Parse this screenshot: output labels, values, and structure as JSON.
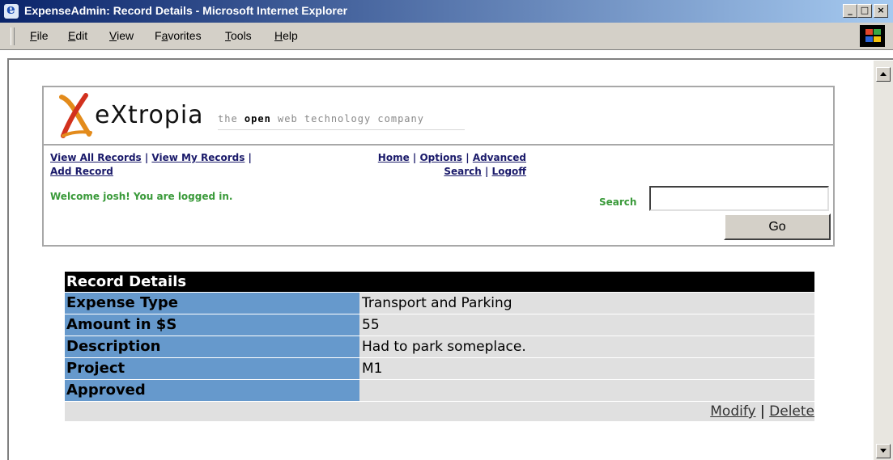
{
  "window": {
    "title": "ExpenseAdmin: Record Details - Microsoft Internet Explorer",
    "controls": {
      "minimize": "_",
      "maximize": "□",
      "close": "×"
    }
  },
  "menubar": {
    "items": [
      {
        "pre": "",
        "key": "F",
        "post": "ile"
      },
      {
        "pre": "",
        "key": "E",
        "post": "dit"
      },
      {
        "pre": "",
        "key": "V",
        "post": "iew"
      },
      {
        "pre": "F",
        "key": "a",
        "post": "vorites"
      },
      {
        "pre": "",
        "key": "T",
        "post": "ools"
      },
      {
        "pre": "",
        "key": "H",
        "post": "elp"
      }
    ]
  },
  "header": {
    "logo_text": "eXtropia",
    "tagline_pre": "the ",
    "tagline_open": "open",
    "tagline_post": " web technology company"
  },
  "nav": {
    "view_all": "View All Records",
    "view_my": "View My Records",
    "add_record": "Add Record",
    "home": "Home",
    "options": "Options",
    "advanced_search_1": "Advanced",
    "advanced_search_2": "Search",
    "logoff": "Logoff",
    "separator": " | ",
    "trailing_sep": " |"
  },
  "welcome": "Welcome josh! You are logged in.",
  "search": {
    "label": "Search",
    "value": "",
    "button": "Go"
  },
  "record": {
    "title": "Record Details",
    "rows": [
      {
        "label": "Expense Type",
        "value": "Transport and Parking"
      },
      {
        "label": "Amount in $S",
        "value": "55"
      },
      {
        "label": "Description",
        "value": "Had to park someplace."
      },
      {
        "label": "Project",
        "value": "M1"
      },
      {
        "label": "Approved",
        "value": ""
      }
    ],
    "modify": "Modify",
    "delete": "Delete",
    "separator": " | "
  },
  "colors": {
    "label_bg": "#6699cc",
    "value_bg": "#e0e0e0",
    "header_bg": "#000000",
    "welcome_text": "#3a9a3a",
    "titlebar_start": "#0a246a"
  }
}
